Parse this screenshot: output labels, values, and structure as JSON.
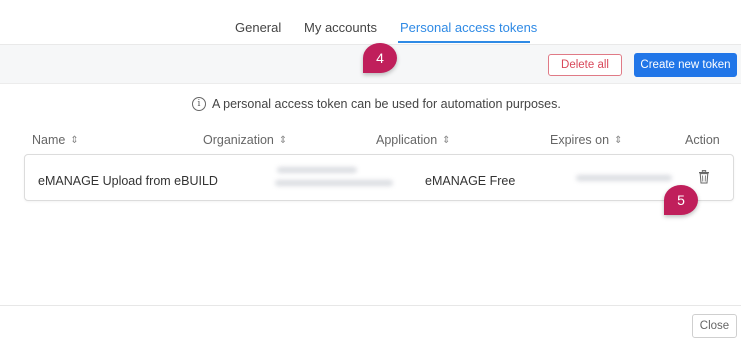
{
  "tabs": [
    {
      "label": "General"
    },
    {
      "label": "My accounts"
    },
    {
      "label": "Personal access tokens",
      "active": true
    }
  ],
  "toolbar": {
    "delete_all_label": "Delete all",
    "create_token_label": "Create new token"
  },
  "info": {
    "icon": "info-icon",
    "text": "A personal access token can be used for automation purposes."
  },
  "table": {
    "columns": [
      "Name",
      "Organization",
      "Application",
      "Expires on",
      "Action"
    ],
    "sort_icon": "sort-icon",
    "rows": [
      {
        "name": "eMANAGE Upload from eBUILD",
        "organization": "",
        "application": "eMANAGE Free",
        "expires_on": "",
        "action_icon": "trash-icon"
      }
    ]
  },
  "footer": {
    "close_label": "Close"
  },
  "annotations": [
    {
      "label": "4"
    },
    {
      "label": "5"
    }
  ],
  "colors": {
    "accent": "#2f8ae5",
    "primary_button": "#2176e8",
    "danger": "#d9485a",
    "callout": "#c01f5b"
  }
}
